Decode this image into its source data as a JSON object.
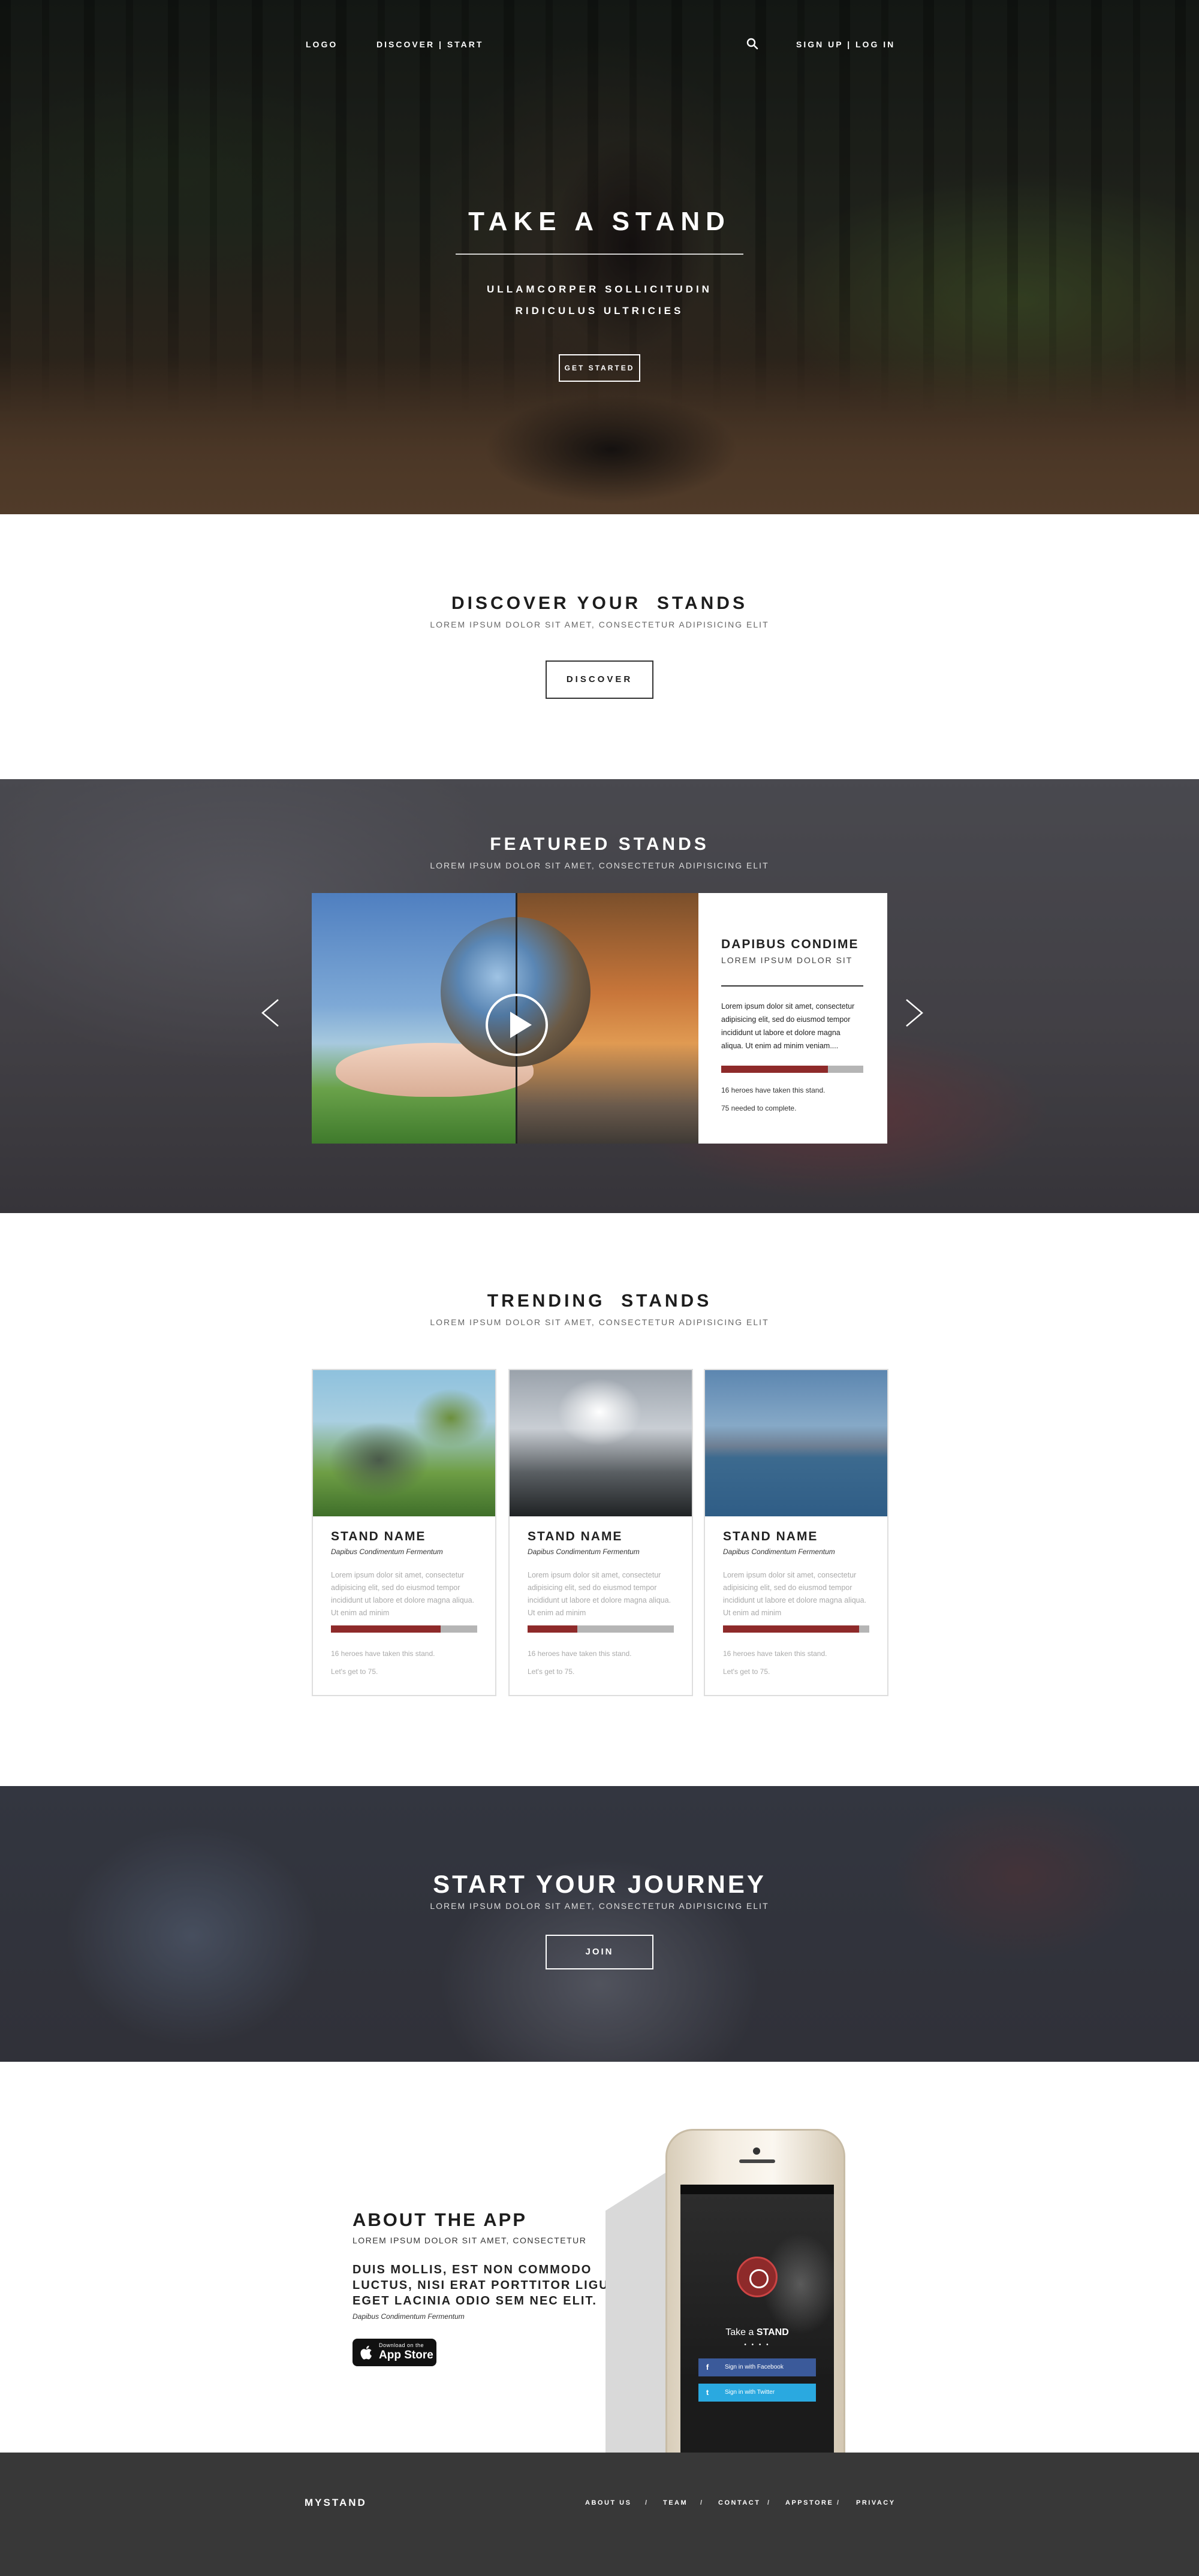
{
  "nav": {
    "logo": "LOGO",
    "discover_start": "DISCOVER | START",
    "auth": "SIGN UP | LOG IN",
    "search_icon": "search-icon"
  },
  "hero": {
    "title": "TAKE A STAND",
    "subtitle_line1": "ULLAMCORPER SOLLICITUDIN",
    "subtitle_line2": "RIDICULUS ULTRICIES",
    "button": "GET STARTED"
  },
  "discover": {
    "title": "DISCOVER YOUR  STANDS",
    "subtitle": "LOREM IPSUM DOLOR SIT AMET, CONSECTETUR ADIPISICING ELIT",
    "button": "DISCOVER"
  },
  "featured": {
    "title": "FEATURED STANDS",
    "subtitle": "LOREM IPSUM DOLOR SIT AMET, CONSECTETUR ADIPISICING ELIT",
    "card": {
      "title": "DAPIBUS CONDIME",
      "subtitle": "LOREM IPSUM DOLOR SIT",
      "description": "Lorem ipsum dolor sit amet, consectetur adipisicing elit, sed do eiusmod tempor incididunt ut labore et dolore magna aliqua. Ut enim ad minim veniam....",
      "progress": 0.75,
      "stat1": "16 heroes have taken this stand.",
      "stat2": "75 needed to complete."
    }
  },
  "trending": {
    "title": "TRENDING  STANDS",
    "subtitle": "LOREM IPSUM DOLOR SIT AMET, CONSECTETUR ADIPISICING ELIT",
    "cards": [
      {
        "name": "STAND NAME",
        "sub": "Dapibus Condimentum Fermentum",
        "desc": "Lorem ipsum dolor sit amet, consectetur adipisicing elit, sed do eiusmod tempor incididunt ut labore et dolore magna aliqua. Ut enim ad minim",
        "progress": 0.75,
        "stat1": "16 heroes have taken this stand.",
        "stat2": "Let's get to 75."
      },
      {
        "name": "STAND NAME",
        "sub": "Dapibus Condimentum Fermentum",
        "desc": "Lorem ipsum dolor sit amet, consectetur adipisicing elit, sed do eiusmod tempor incididunt ut labore et dolore magna aliqua. Ut enim ad minim",
        "progress": 0.34,
        "stat1": "16 heroes have taken this stand.",
        "stat2": "Let's get to 75."
      },
      {
        "name": "STAND NAME",
        "sub": "Dapibus Condimentum Fermentum",
        "desc": "Lorem ipsum dolor sit amet, consectetur adipisicing elit, sed do eiusmod tempor incididunt ut labore et dolore magna aliqua. Ut enim ad minim",
        "progress": 0.93,
        "stat1": "16 heroes have taken this stand.",
        "stat2": "Let's get to 75."
      }
    ]
  },
  "journey": {
    "title": "START YOUR JOURNEY",
    "subtitle": "LOREM IPSUM DOLOR SIT AMET, CONSECTETUR ADIPISICING ELIT",
    "button": "JOIN"
  },
  "about": {
    "title": "ABOUT THE APP",
    "subtitle": "LOREM IPSUM DOLOR SIT AMET, CONSECTETUR",
    "lead": "DUIS MOLLIS, EST NON COMMODO LUCTUS, NISI ERAT PORTTITOR LIGULA, EGET LACINIA ODIO SEM NEC ELIT.",
    "caption": "Dapibus Condimentum Fermentum",
    "appstore_small": "Download on the",
    "appstore_big": "App Store",
    "phone": {
      "tagline_light": "Take a ",
      "tagline_bold": "STAND",
      "facebook": "Sign in with Facebook",
      "twitter": "Sign in with Twitter"
    }
  },
  "footer": {
    "brand": "MYSTAND",
    "links": [
      "ABOUT US",
      "TEAM",
      "CONTACT",
      "APPSTORE",
      "PRIVACY"
    ]
  },
  "colors": {
    "accent_red": "#8e2a2a",
    "progress_track": "#b5b5b5",
    "footer_bg": "#383838"
  }
}
